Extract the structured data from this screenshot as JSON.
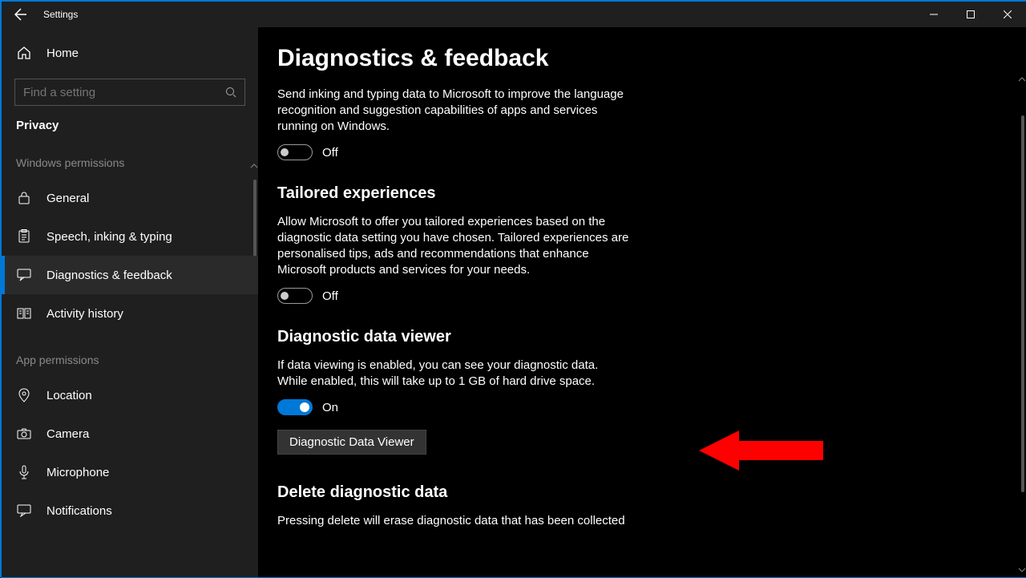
{
  "window": {
    "title": "Settings"
  },
  "sidebar": {
    "home": "Home",
    "search_placeholder": "Find a setting",
    "category": "Privacy",
    "group1": "Windows permissions",
    "group2": "App permissions",
    "items": {
      "general": "General",
      "speech": "Speech, inking & typing",
      "diag": "Diagnostics & feedback",
      "activity": "Activity history",
      "location": "Location",
      "camera": "Camera",
      "microphone": "Microphone",
      "notifications": "Notifications"
    }
  },
  "page": {
    "title": "Diagnostics & feedback",
    "inking_desc": "Send inking and typing data to Microsoft to improve the language recognition and suggestion capabilities of apps and services running on Windows.",
    "off": "Off",
    "on": "On",
    "tailored_h": "Tailored experiences",
    "tailored_desc": "Allow Microsoft to offer you tailored experiences based on the diagnostic data setting you have chosen. Tailored experiences are personalised tips, ads and recommendations that enhance Microsoft products and services for your needs.",
    "viewer_h": "Diagnostic data viewer",
    "viewer_desc": "If data viewing is enabled, you can see your diagnostic data. While enabled, this will take up to 1 GB of hard drive space.",
    "viewer_btn": "Diagnostic Data Viewer",
    "delete_h": "Delete diagnostic data",
    "delete_desc": "Pressing delete will erase diagnostic data that has been collected"
  }
}
